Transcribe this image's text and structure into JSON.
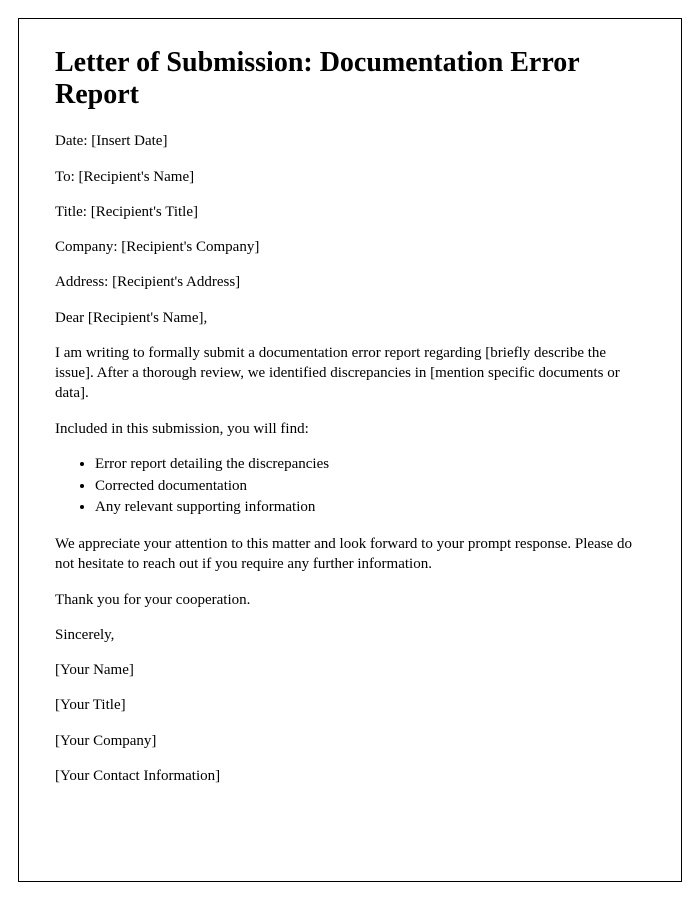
{
  "title": "Letter of Submission: Documentation Error Report",
  "fields": {
    "date": "Date: [Insert Date]",
    "to": "To: [Recipient's Name]",
    "recipient_title": "Title: [Recipient's Title]",
    "company": "Company: [Recipient's Company]",
    "address": "Address: [Recipient's Address]"
  },
  "salutation": "Dear [Recipient's Name],",
  "body": {
    "intro": "I am writing to formally submit a documentation error report regarding [briefly describe the issue]. After a thorough review, we identified discrepancies in [mention specific documents or data].",
    "included_lead": "Included in this submission, you will find:",
    "items": [
      "Error report detailing the discrepancies",
      "Corrected documentation",
      "Any relevant supporting information"
    ],
    "closing1": "We appreciate your attention to this matter and look forward to your prompt response. Please do not hesitate to reach out if you require any further information.",
    "closing2": "Thank you for your cooperation."
  },
  "signoff": {
    "sincerely": "Sincerely,",
    "name": "[Your Name]",
    "title": "[Your Title]",
    "company": "[Your Company]",
    "contact": "[Your Contact Information]"
  }
}
